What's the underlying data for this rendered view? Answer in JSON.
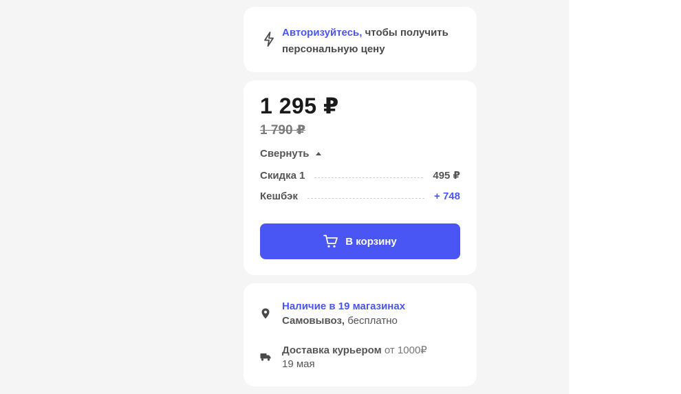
{
  "auth": {
    "link_text": "Авторизуйтесь,",
    "rest_text": " чтобы получить персональную цену",
    "icon": "lightning-icon"
  },
  "price": {
    "current": "1 295 ₽",
    "old": "1 790 ₽",
    "collapse_label": "Свернуть",
    "discount_label": "Скидка 1",
    "discount_value": "495 ₽",
    "cashback_label": "Кешбэк",
    "cashback_value": "+ 748",
    "cart_button": "В корзину"
  },
  "stock": {
    "availability": "Наличие в 19 магазинах",
    "pickup_bold": "Самовывоз,",
    "pickup_rest": " бесплатно",
    "delivery_bold": "Доставка курьером",
    "delivery_rest": " от 1000₽",
    "delivery_date": "19 мая"
  },
  "colors": {
    "accent": "#4a56f4",
    "background": "#f5f5f5"
  }
}
